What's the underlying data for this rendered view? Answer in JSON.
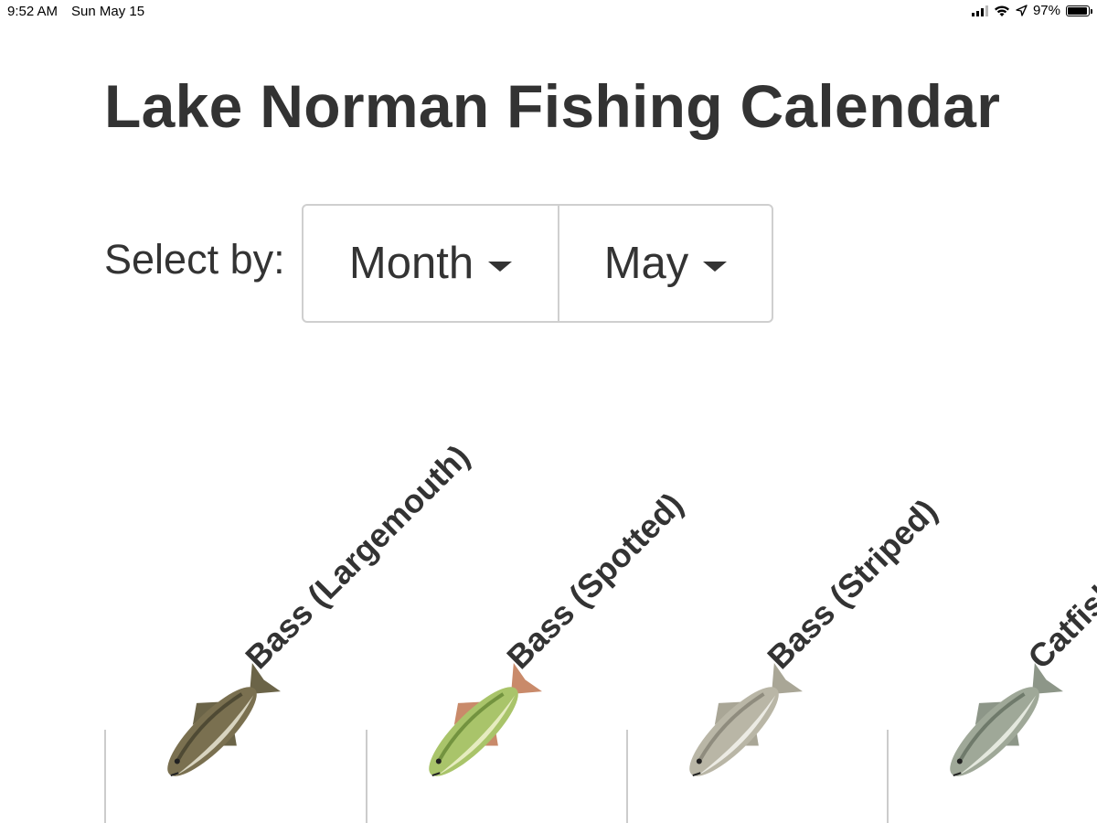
{
  "status_bar": {
    "time": "9:52 AM",
    "date": "Sun May 15",
    "battery_percent": "97%",
    "battery_level": 0.97,
    "icons": [
      "cellular-signal-icon",
      "wifi-icon",
      "location-arrow-icon",
      "battery-icon"
    ]
  },
  "page": {
    "title": "Lake Norman Fishing Calendar"
  },
  "selector": {
    "label": "Select by:",
    "mode_value": "Month",
    "period_value": "May"
  },
  "fish": [
    {
      "name": "Bass (Largemouth)",
      "icon": "largemouth-bass-image",
      "colors": {
        "body": "#7a7050",
        "belly": "#d8d4c0",
        "dark": "#3d3a28",
        "fin": "#6b6448"
      }
    },
    {
      "name": "Bass (Spotted)",
      "icon": "spotted-bass-image",
      "colors": {
        "body": "#a9c46a",
        "belly": "#e6ecc0",
        "dark": "#5d7f2e",
        "fin": "#c98a6a"
      }
    },
    {
      "name": "Bass (Striped)",
      "icon": "striped-bass-image",
      "colors": {
        "body": "#b9b6a6",
        "belly": "#ecebe4",
        "dark": "#7d7a6e",
        "fin": "#a9a696"
      }
    },
    {
      "name": "Catfish",
      "icon": "catfish-image",
      "colors": {
        "body": "#9fa898",
        "belly": "#e4e8de",
        "dark": "#5b6658",
        "fin": "#8d9688"
      }
    }
  ]
}
